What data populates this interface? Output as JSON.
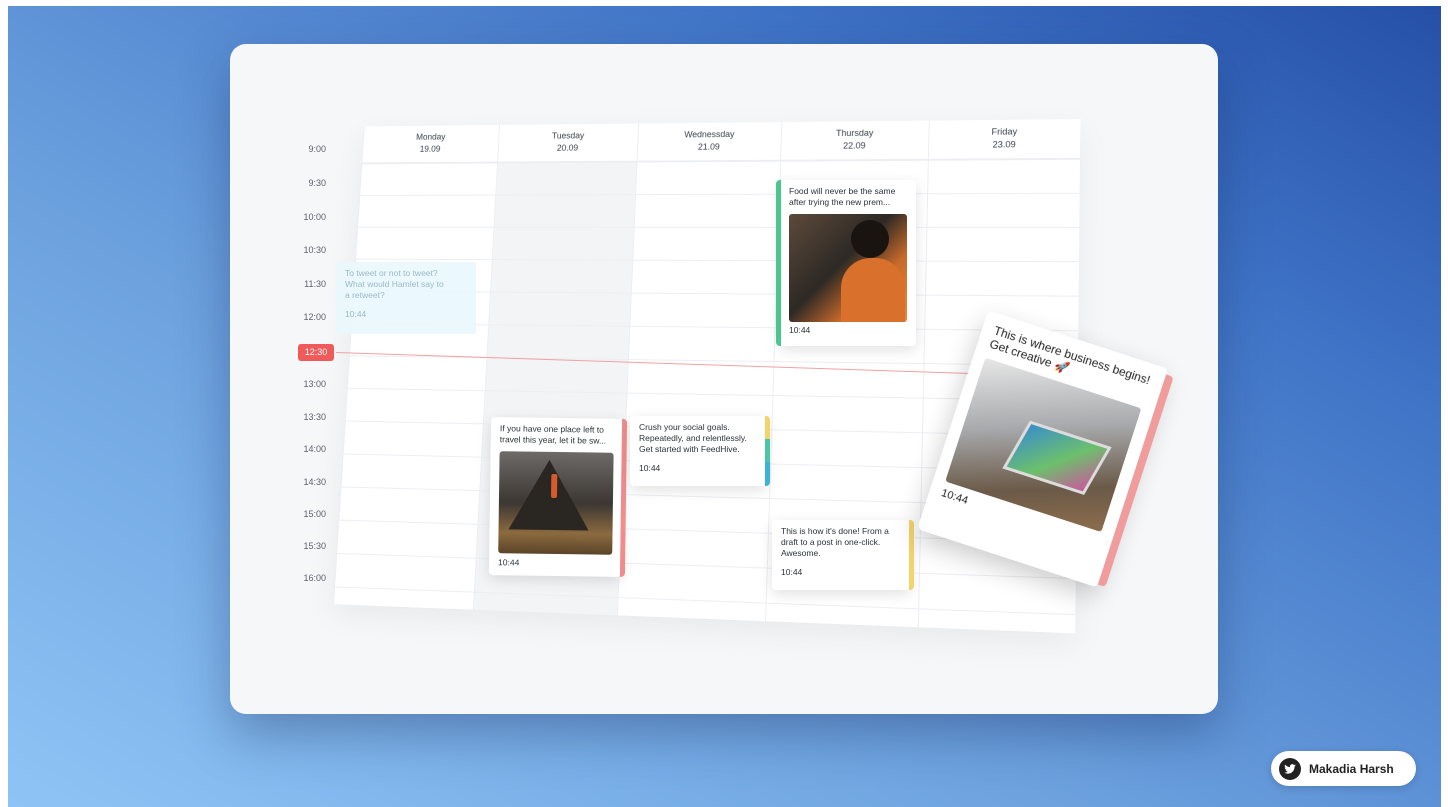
{
  "calendar": {
    "days": [
      {
        "name": "Monday",
        "date": "19.09"
      },
      {
        "name": "Tuesday",
        "date": "20.09"
      },
      {
        "name": "Wednessday",
        "date": "21.09"
      },
      {
        "name": "Thursday",
        "date": "22.09"
      },
      {
        "name": "Friday",
        "date": "23.09"
      }
    ],
    "times": [
      "9:00",
      "9:30",
      "10:00",
      "10:30",
      "11:30",
      "12:00",
      "13:00",
      "13:30",
      "14:00",
      "14:30",
      "15:00",
      "15:30",
      "16:00"
    ],
    "current_time": "12:30"
  },
  "posts": {
    "ghost": {
      "text": "To tweet or not to tweet? What would Hamlet say to a retweet?",
      "time": "10:44"
    },
    "thursday_food": {
      "text": "Food will never be the same after trying the new prem...",
      "time": "10:44",
      "accent": "#4cc58f",
      "image_icon": "person-eating-photo"
    },
    "tuesday_travel": {
      "text": "If you have one place left to travel this year, let it be sw...",
      "time": "10:44",
      "accent": "#f08c8c",
      "image_icon": "mountain-photo"
    },
    "wednesday_goals": {
      "text": "Crush your social goals. Repeatedly, and relentlessly. Get started with FeedHive.",
      "time": "10:44",
      "accent": "#3bb4d8"
    },
    "thursday_draft": {
      "text": "This is how it's done! From a draft to a post in one-click. Awesome.",
      "time": "10:44",
      "accent": "#f3d36b"
    },
    "dragged": {
      "text": "This is where business begins! Get creative 🚀",
      "time": "10:44",
      "accent": "#f09c9c",
      "image_icon": "laptop-photo"
    }
  },
  "author": {
    "name": "Makadia Harsh",
    "icon": "bird-icon"
  }
}
